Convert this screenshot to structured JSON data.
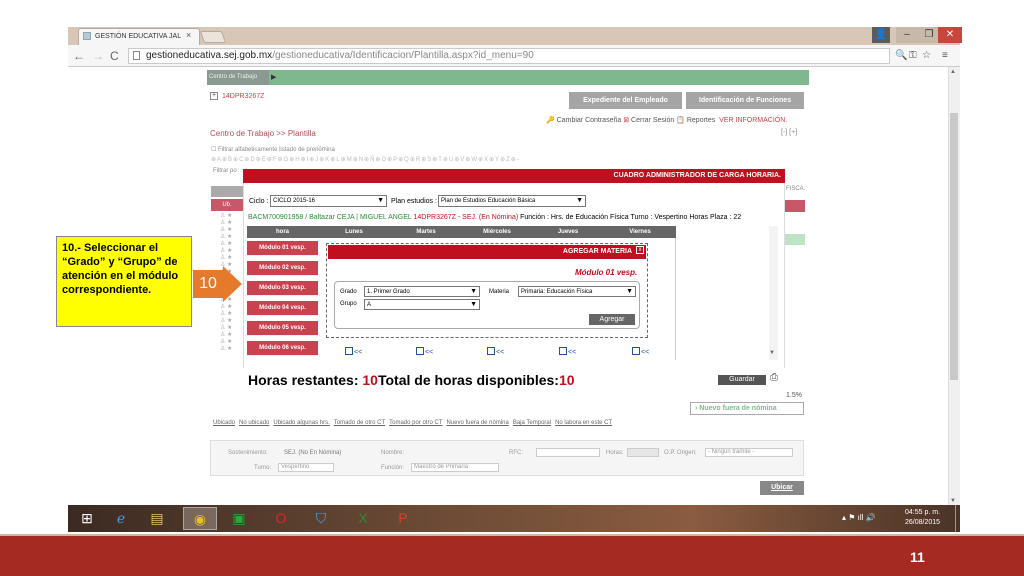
{
  "browser": {
    "tab_title": "GESTIÓN EDUCATIVA JAL",
    "tab_close": "×",
    "url_host": "gestioneducativa.sej.gob.mx",
    "url_path": "/gestioneducativa/Identificacion/Plantilla.aspx?id_menu=90",
    "back": "←",
    "forward": "→",
    "reload": "C",
    "win_min": "–",
    "win_max": "❐",
    "win_close": "✕"
  },
  "page": {
    "ct_label": "Centro de Trabajo",
    "ct_code": "14DPR3267Z",
    "btn_expediente": "Expediente del Empleado",
    "btn_identificacion": "Identificación de Funciones",
    "link_cambiar": "Cambiar Contraseña",
    "link_cerrar": "Cerrar Sesión",
    "link_reportes": "Reportes",
    "link_ver_info": "VER INFORMACIÓN.",
    "breadcrumb": "Centro de Trabajo >> Plantilla",
    "bc_buttons": "[-] [+]",
    "filter_line": "Filtrar alfabeticamente listado de prenómina",
    "filter_po": "Filtrar po",
    "alpha_line": "⊕A⊕B⊕C⊕D⊕E⊕F⊕G⊕H⊕I⊕J⊕K⊕L⊕M⊕N⊕Ñ⊕O⊕P⊕Q⊕R⊕S⊕T⊕U⊕V⊕W⊕X⊕Y⊕Z⊕-",
    "col_red": "Ub.",
    "fisca": "FISCA.",
    "pct": "1.5%",
    "btn_nuevo": "Nuevo fuera de nómina",
    "legend": [
      "Ubicado",
      "No ubicado",
      "Ubicado algunas hrs.",
      "Tomado de otro CT",
      "Tomado por otro CT",
      "Nuevo fuera de nómina",
      "Baja Temporal",
      "No labora en este CT"
    ],
    "search": {
      "sostenimiento_label": "Sostenimiento:",
      "sostenimiento_value": "SEJ. (No En Nómina)",
      "nombre_label": "Nombre:",
      "rfc_label": "RFC:",
      "horas_label": "Horas:",
      "op_origen_label": "O.P. Origen:",
      "op_origen_value": "- Ningún trámite -",
      "turno_label": "Turno:",
      "turno_value": "Vespertino",
      "funcion_label": "Función:",
      "funcion_value": "Maestro de Primaria"
    },
    "btn_ubicar": "Ubicar"
  },
  "modal": {
    "title": "CUADRO ADMINISTRADOR DE CARGA HORARIA.",
    "ciclo_label": "Ciclo :",
    "ciclo_value": "CICLO 2015-16",
    "plan_label": "Plan estudios :",
    "plan_value": "Plan de Estudios Educación Básica",
    "employee_code": "BACM700901958",
    "employee_name": "/ Baltazar CEJA | MIGUEL ANGEL",
    "employee_ct": "14DPR3267Z - SEJ. (En Nómina)",
    "employee_function": "Función : Hrs. de Educación Física  Turno : Vespertino  Horas Plaza : 22",
    "schedule_headers": [
      "hora",
      "Lunes",
      "Martes",
      "Miércoles",
      "Jueves",
      "Viernes"
    ],
    "modules": [
      "Módulo 01 vesp.",
      "Módulo 02 vesp.",
      "Módulo 03 vesp.",
      "Módulo 04 vesp.",
      "Módulo 05 vesp.",
      "Módulo 06 vesp."
    ],
    "slot_label": "<<",
    "horas_restantes_label": "Horas restantes: ",
    "horas_restantes_value": "10",
    "total_label": "Total de horas disponibles:",
    "total_value": "10",
    "btn_guardar": "Guardar"
  },
  "agregar": {
    "title": "AGREGAR MATERIA",
    "close": "x",
    "module": "Módulo 01 vesp.",
    "grado_label": "Grado",
    "grado_value": "1. Primer Grado",
    "materia_label": "Materia",
    "materia_value": "Primaria: Educación Física",
    "grupo_label": "Grupo",
    "grupo_value": "A",
    "btn_agregar": "Agregar"
  },
  "callout": {
    "text": "10.- Seleccionar el “Grado” y “Grupo” de atención en el módulo correspondiente.",
    "step": "10"
  },
  "taskbar": {
    "time": "04:55 p. m.",
    "date": "26/08/2015"
  },
  "slide": {
    "number": "11"
  }
}
